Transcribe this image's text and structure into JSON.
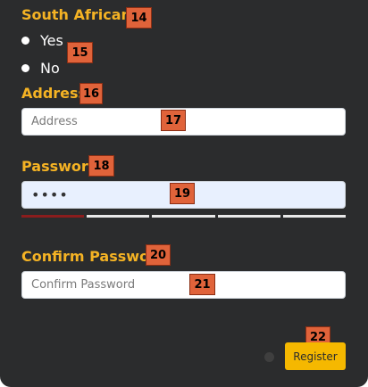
{
  "south_african": {
    "label": "South African?",
    "badge": "14",
    "options": [
      {
        "label": "Yes"
      },
      {
        "label": "No"
      }
    ],
    "options_badge": "15"
  },
  "address": {
    "label": "Address",
    "label_badge": "16",
    "placeholder": "Address",
    "value": "",
    "input_badge": "17"
  },
  "password": {
    "label": "Password",
    "label_badge": "18",
    "value": "••••",
    "input_badge": "19",
    "strength_level": 0.2
  },
  "confirm_password": {
    "label": "Confirm Password",
    "label_badge": "20",
    "placeholder": "Confirm Password",
    "value": "",
    "input_badge": "21"
  },
  "register": {
    "label": "Register",
    "badge": "22"
  },
  "colors": {
    "panel_bg": "#2b2c2d",
    "accent": "#f5b324",
    "button": "#f5b800",
    "badge": "#e0633a",
    "strength_weak": "#8b1d1d"
  }
}
